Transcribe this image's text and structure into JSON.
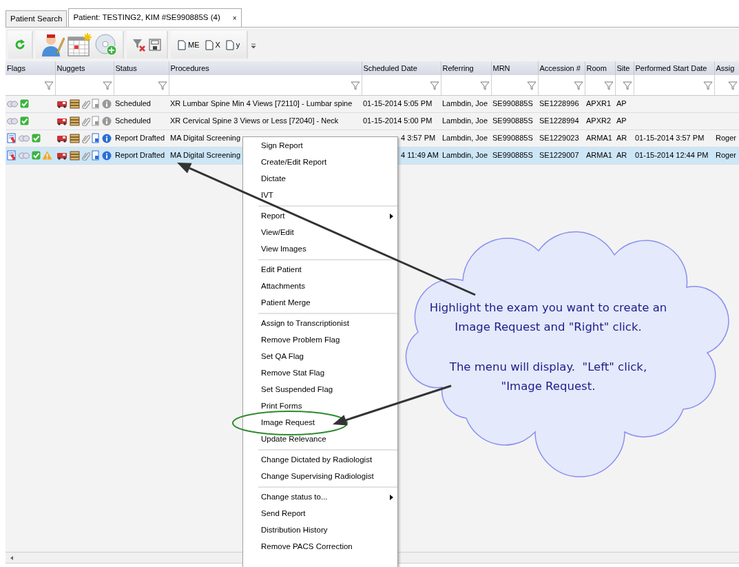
{
  "tabs": [
    {
      "label": "Patient Search",
      "selected": false
    },
    {
      "label": "Patient: TESTING2, KIM #SE990885S (4)",
      "selected": true,
      "close": "×"
    }
  ],
  "toolbar": {
    "groups": [
      {
        "items": [
          {
            "kind": "refresh"
          }
        ]
      },
      {
        "items": [
          {
            "kind": "doctor-edit"
          },
          {
            "kind": "calendar"
          },
          {
            "kind": "disc-add"
          }
        ]
      },
      {
        "items": [
          {
            "kind": "filter-clear"
          },
          {
            "kind": "save"
          }
        ]
      },
      {
        "items": [
          {
            "kind": "document",
            "label": "ME"
          },
          {
            "kind": "document",
            "label": "X"
          },
          {
            "kind": "document",
            "label": "y"
          }
        ]
      }
    ]
  },
  "table": {
    "columns": [
      "Flags",
      "Nuggets",
      "Status",
      "Procedures",
      "Scheduled Date",
      "Referring",
      "MRN",
      "Accession #",
      "Room",
      "Site",
      "Performed Start Date",
      "Assig"
    ],
    "rows": [
      {
        "selected": false,
        "flags": [
          {
            "kind": "link"
          },
          {
            "kind": "check"
          }
        ],
        "nuggets_active": false,
        "status": "Scheduled",
        "procedure": "XR Lumbar Spine Min 4 Views [72110] - Lumbar spine",
        "scheduled_date": "01-15-2014 5:05 PM",
        "referring": "Lambdin, Joe",
        "mrn": "SE990885S",
        "accession": "SE1228996",
        "room": "APXR1",
        "site": "AP"
      },
      {
        "selected": false,
        "flags": [
          {
            "kind": "link"
          },
          {
            "kind": "check"
          }
        ],
        "nuggets_active": false,
        "status": "Scheduled",
        "procedure": "XR Cervical Spine 3 Views or Less [72040] - Neck",
        "scheduled_date": "01-15-2014 5:00 PM",
        "referring": "Lambdin, Joe",
        "mrn": "SE990885S",
        "accession": "SE1228994",
        "room": "APXR2",
        "site": "AP"
      },
      {
        "selected": false,
        "flags": [
          {
            "kind": "stat-report"
          },
          {
            "kind": "link"
          },
          {
            "kind": "check"
          }
        ],
        "nuggets_active": true,
        "status": "Report Drafted",
        "procedure": "MA Digital Screening",
        "scheduled_date": "4 3:57 PM",
        "referring": "Lambdin, Joe",
        "mrn": "SE990885S",
        "accession": "SE1229023",
        "room": "ARMA1",
        "site": "AR",
        "performed_start_date": "01-15-2014 3:57 PM",
        "assigned": "Roger"
      },
      {
        "selected": true,
        "flags": [
          {
            "kind": "stat-report"
          },
          {
            "kind": "link"
          },
          {
            "kind": "check"
          },
          {
            "kind": "warning"
          }
        ],
        "nuggets_active": true,
        "status": "Report Drafted",
        "procedure": "MA Digital Screening",
        "scheduled_date": "4 11:49 AM",
        "referring": "Lambdin, Joe",
        "mrn": "SE990885S",
        "accession": "SE1229007",
        "room": "ARMA1",
        "site": "AR",
        "performed_start_date": "01-15-2014 12:44 PM",
        "assigned": "Roger"
      }
    ]
  },
  "context_menu": {
    "groups": [
      {
        "items": [
          {
            "label": "Sign Report",
            "submenu": false,
            "circled": false
          },
          {
            "label": "Create/Edit Report",
            "submenu": false,
            "circled": false
          },
          {
            "label": "Dictate",
            "submenu": false,
            "circled": false
          },
          {
            "label": "IVT",
            "submenu": false,
            "circled": false
          }
        ]
      },
      {
        "items": [
          {
            "label": "Report",
            "submenu": true,
            "circled": false
          },
          {
            "label": "View/Edit",
            "submenu": false,
            "circled": false
          },
          {
            "label": "View Images",
            "submenu": false,
            "circled": false
          }
        ]
      },
      {
        "items": [
          {
            "label": "Edit Patient",
            "submenu": false,
            "circled": false
          },
          {
            "label": "Attachments",
            "submenu": false,
            "circled": false
          },
          {
            "label": "Patient Merge",
            "submenu": false,
            "circled": false
          }
        ]
      },
      {
        "items": [
          {
            "label": "Assign to Transcriptionist",
            "submenu": false,
            "circled": false
          },
          {
            "label": "Remove Problem Flag",
            "submenu": false,
            "circled": false
          },
          {
            "label": "Set QA Flag",
            "submenu": false,
            "circled": false
          },
          {
            "label": "Remove Stat Flag",
            "submenu": false,
            "circled": false
          },
          {
            "label": "Set Suspended Flag",
            "submenu": false,
            "circled": false
          },
          {
            "label": "Print Forms",
            "submenu": false,
            "circled": false
          },
          {
            "label": "Image Request",
            "submenu": false,
            "circled": true
          },
          {
            "label": "Update Relevance",
            "submenu": false,
            "circled": false
          }
        ]
      },
      {
        "items": [
          {
            "label": "Change Dictated by Radiologist",
            "submenu": false,
            "circled": false
          },
          {
            "label": "Change Supervising Radiologist",
            "submenu": false,
            "circled": false
          }
        ]
      },
      {
        "items": [
          {
            "label": "Change status to...",
            "submenu": true,
            "circled": false
          },
          {
            "label": "Send Report",
            "submenu": false,
            "circled": false
          },
          {
            "label": "Distribution History",
            "submenu": false,
            "circled": false
          },
          {
            "label": "Remove PACS Correction",
            "submenu": false,
            "circled": false
          }
        ]
      }
    ]
  },
  "callout": {
    "paragraphs": [
      {
        "lines": [
          "Highlight the exam you want to create an",
          "Image Request and \"Right\" click."
        ]
      },
      {
        "lines": [
          "The menu will display.  \"Left\" click,",
          "\"Image Request."
        ]
      }
    ]
  }
}
